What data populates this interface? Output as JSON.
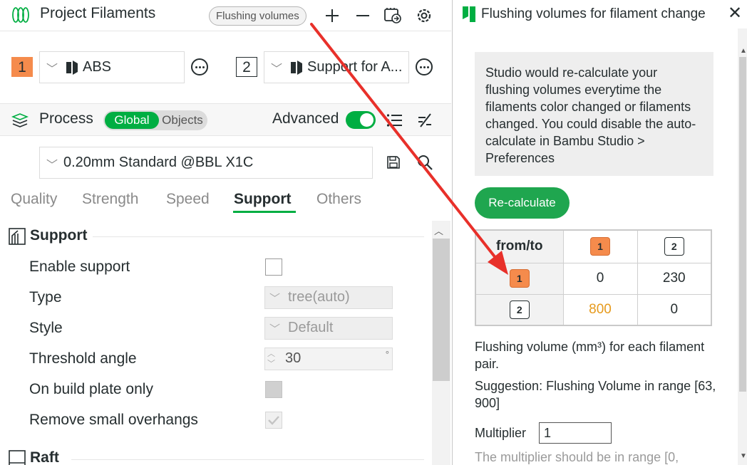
{
  "left_panel": {
    "filaments_title": "Project Filaments",
    "flushing_tag": "Flushing volumes",
    "filament1": {
      "number": "1",
      "name": "ABS",
      "color": "#f58b4c"
    },
    "filament2": {
      "number": "2",
      "name": "Support for A..."
    },
    "process_title": "Process",
    "mode_global": "Global",
    "mode_objects": "Objects",
    "advanced_label": "Advanced",
    "advanced_on": true,
    "preset_name": "0.20mm Standard @BBL X1C",
    "tabs": [
      "Quality",
      "Strength",
      "Speed",
      "Support",
      "Others"
    ],
    "active_tab": "Support",
    "section_support": "Support",
    "section_raft": "Raft",
    "options": {
      "enable_support": "Enable support",
      "type": "Type",
      "type_value": "tree(auto)",
      "style": "Style",
      "style_value": "Default",
      "threshold_angle": "Threshold angle",
      "threshold_value": "30",
      "threshold_unit": "°",
      "on_build_plate_only": "On build plate only",
      "remove_small_overhangs": "Remove small overhangs"
    },
    "icons": [
      "filament-spool-icon",
      "plus-icon",
      "minus-icon",
      "sync-ams-icon",
      "gear-icon",
      "more-options-icon",
      "process-layers-icon",
      "list-icon",
      "compare-icon",
      "save-icon",
      "search-icon",
      "support-section-icon",
      "raft-section-icon",
      "brand-cube-icon"
    ]
  },
  "dialog": {
    "title": "Flushing volumes for filament change",
    "info_text": "Studio would re-calculate your flushing volumes everytime the filaments color changed or filaments changed. You could disable the auto-calculate in Bambu Studio > Preferences",
    "recalc_label": "Re-calculate",
    "table": {
      "corner": "from/to",
      "col_headers": [
        "1",
        "2"
      ],
      "rows": [
        {
          "from": "1",
          "values": [
            "0",
            "230"
          ]
        },
        {
          "from": "2",
          "values": [
            "800",
            "0"
          ]
        }
      ]
    },
    "flushing_note": "Flushing volume (mm³) for each filament pair.",
    "suggestion": "Suggestion: Flushing Volume in range [63, 900]",
    "multiplier_label": "Multiplier",
    "multiplier_value": "1",
    "multiplier_hint": "The multiplier should be in range [0,",
    "accent_color": "#1fa64f",
    "highlight_color": "#e69a1c"
  },
  "annotation_arrow_color": "#e8302a"
}
